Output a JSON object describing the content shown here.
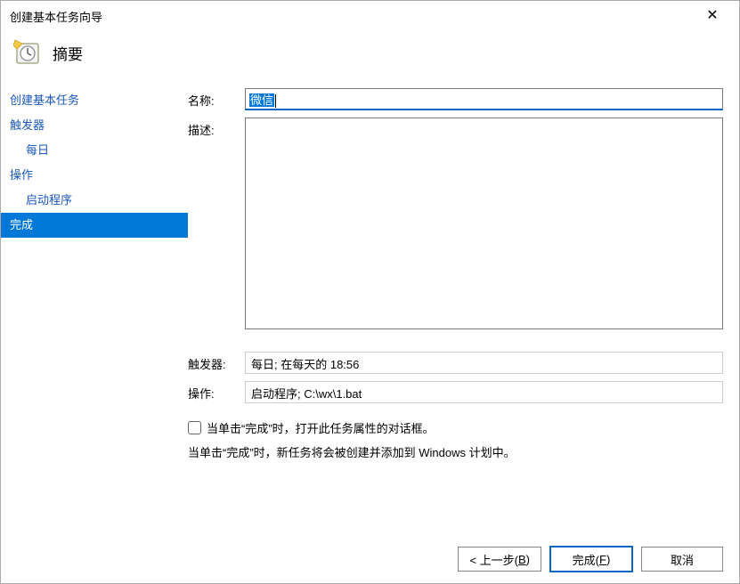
{
  "window": {
    "title": "创建基本任务向导"
  },
  "header": {
    "title": "摘要"
  },
  "sidebar": {
    "items": [
      {
        "label": "创建基本任务",
        "indent": 0,
        "active": false
      },
      {
        "label": "触发器",
        "indent": 0,
        "active": false
      },
      {
        "label": "每日",
        "indent": 1,
        "active": false
      },
      {
        "label": "操作",
        "indent": 0,
        "active": false
      },
      {
        "label": "启动程序",
        "indent": 1,
        "active": false
      },
      {
        "label": "完成",
        "indent": 0,
        "active": true
      }
    ]
  },
  "form": {
    "name_label": "名称:",
    "name_value": "微信",
    "desc_label": "描述:",
    "desc_value": "",
    "trigger_label": "触发器:",
    "trigger_value": "每日;  在每天的 18:56",
    "action_label": "操作:",
    "action_value": "启动程序; C:\\wx\\1.bat",
    "open_properties_checked": false,
    "open_properties_label": "当单击“完成”时，打开此任务属性的对话框。",
    "note": "当单击“完成”时，新任务将会被创建并添加到 Windows 计划中。"
  },
  "buttons": {
    "back": "< 上一步(B)",
    "back_accel": "B",
    "finish": "完成(F)",
    "finish_accel": "F",
    "cancel": "取消"
  }
}
